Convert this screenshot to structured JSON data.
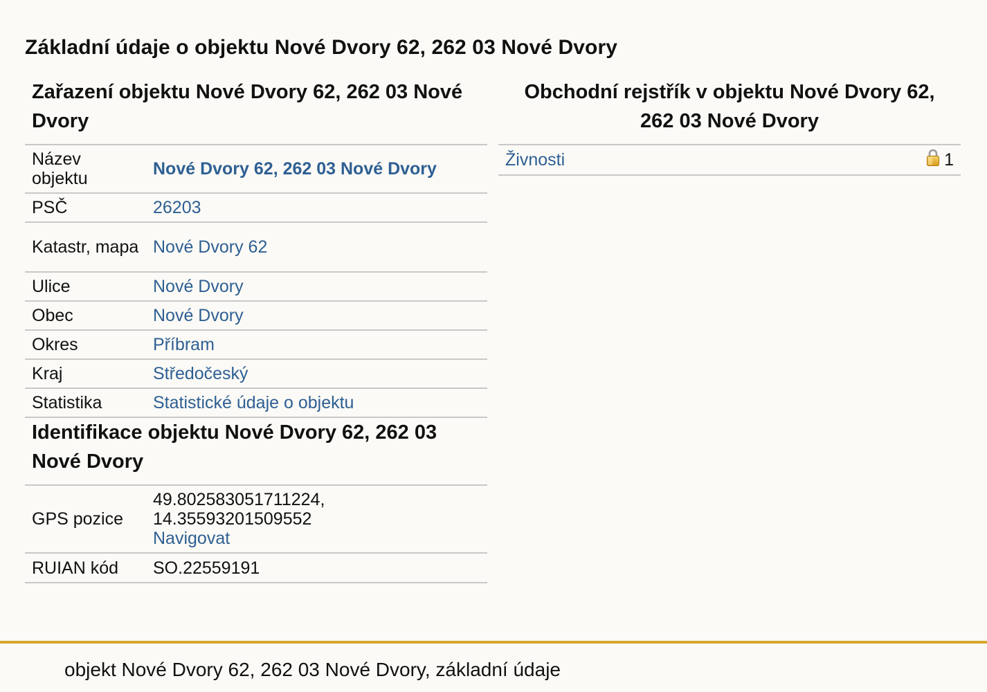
{
  "page": {
    "title": "Základní údaje o objektu Nové Dvory 62, 262 03 Nové Dvory"
  },
  "classification": {
    "title": "Zařazení objektu Nové Dvory 62, 262 03 Nové Dvory",
    "rows": [
      {
        "label": "Název objektu",
        "value": "Nové Dvory 62, 262 03 Nové Dvory"
      },
      {
        "label": "PSČ",
        "value": "26203"
      },
      {
        "label": "Katastr, mapa",
        "value": "Nové Dvory 62"
      },
      {
        "label": "Ulice",
        "value": "Nové Dvory"
      },
      {
        "label": "Obec",
        "value": "Nové Dvory"
      },
      {
        "label": "Okres",
        "value": "Příbram"
      },
      {
        "label": "Kraj",
        "value": "Středočeský"
      },
      {
        "label": "Statistika",
        "value": "Statistické údaje o objektu"
      }
    ]
  },
  "identification": {
    "title": "Identifikace objektu Nové Dvory 62, 262 03 Nové Dvory",
    "gps": {
      "label": "GPS pozice",
      "lat": "49.802583051711224,",
      "lon": "14.35593201509552",
      "navigate": "Navigovat"
    },
    "ruian": {
      "label": "RUIAN kód",
      "value": "SO.22559191"
    }
  },
  "register": {
    "title": "Obchodní rejstřík v objektu Nové Dvory 62, 262 03 Nové Dvory",
    "rows": [
      {
        "label": "Živnosti",
        "count": "1",
        "icon": "lock-icon"
      }
    ]
  },
  "footer": {
    "text": "objekt Nové Dvory 62, 262 03 Nové Dvory, základní údaje"
  },
  "colors": {
    "link": "#2e5f93",
    "footer_border": "#d6a72e",
    "background": "#fbfaf6",
    "row_border": "#c8c8c8"
  }
}
